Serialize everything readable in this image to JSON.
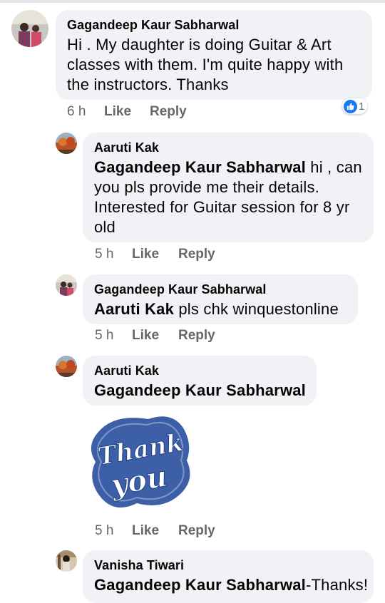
{
  "comments": [
    {
      "author": "Gagandeep Kaur Sabharwal",
      "lines": [
        "Hi . My daughter is doing Guitar & Art",
        "classes with them. I'm quite happy with",
        "the instructors. Thanks"
      ],
      "time": "6 h",
      "like_label": "Like",
      "reply_label": "Reply",
      "reaction_count": "1"
    },
    {
      "author": "Aaruti Kak",
      "mention": "Gagandeep Kaur Sabharwal",
      "lines": [
        " hi , can",
        "you pls provide me their details.",
        "Interested for Guitar session for 8 yr",
        "old"
      ],
      "time": "5 h",
      "like_label": "Like",
      "reply_label": "Reply"
    },
    {
      "author": "Gagandeep Kaur Sabharwal",
      "mention": "Aaruti Kak",
      "text": " pls chk winquestonline",
      "time": "5 h",
      "like_label": "Like",
      "reply_label": "Reply"
    },
    {
      "author": "Aaruti Kak",
      "mention": "Gagandeep Kaur Sabharwal",
      "sticker": {
        "line1": "Thank",
        "line2": "you",
        "color": "#3d5fa8"
      },
      "time": "5 h",
      "like_label": "Like",
      "reply_label": "Reply"
    },
    {
      "author": "Vanisha Tiwari",
      "mention": "Gagandeep Kaur Sabharwal",
      "text": "-Thanks!"
    }
  ],
  "colors": {
    "like_blue": "#1877f2",
    "bubble": "#f0f2f5",
    "meta": "#65676b"
  }
}
